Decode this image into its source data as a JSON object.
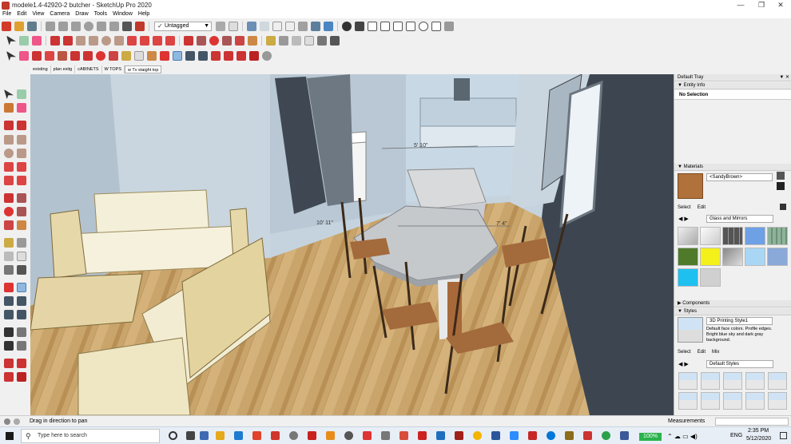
{
  "window": {
    "title": "modele1.4-42920-2 butcher - SketchUp Pro 2020",
    "minimize": "—",
    "restore": "❐",
    "close": "✕"
  },
  "menu": [
    "File",
    "Edit",
    "View",
    "Camera",
    "Draw",
    "Tools",
    "Window",
    "Help"
  ],
  "toolbar": {
    "tag_select": {
      "checkmark": "✓",
      "value": "Untagged",
      "dropdown": "▼"
    }
  },
  "scenes": [
    "existing",
    "plan exitg",
    "cABINETS",
    "W TOPS",
    "w Tv staight top"
  ],
  "active_scene": "w Tv staight top",
  "viewport": {
    "dimension_labels": [
      "5' 10\"",
      "10' 11\"",
      "7' 4\""
    ]
  },
  "tray": {
    "title": "Default Tray",
    "header_buttons": "▼ ✕",
    "entity_info": {
      "label": "Entity Info",
      "value": "No Selection"
    },
    "materials": {
      "label": "Materials",
      "current": "<SandyBrown>",
      "tabs": [
        "Select",
        "Edit"
      ],
      "library": "Glass and Mirrors"
    },
    "components": {
      "label": "Components"
    },
    "styles": {
      "label": "Styles",
      "name": "3D Printing Style1",
      "description": "Default face colors. Profile edges. Bright blue sky and dark gray background.",
      "tabs": [
        "Select",
        "Edit",
        "Mix"
      ],
      "library": "Default Styles"
    }
  },
  "status": {
    "hint": "Drag in direction to pan",
    "measurements_label": "Measurements"
  },
  "taskbar": {
    "search_placeholder": "Type here to search",
    "battery": "100%",
    "language": "ENG",
    "time": "2:35 PM",
    "date": "5/12/2020"
  },
  "colors": {
    "accent": "#0078d7",
    "wall": "#b8c7d3",
    "floor": "#c9a46b",
    "dark_wall": "#3d4650",
    "sandy_brown": "#b0713a"
  }
}
